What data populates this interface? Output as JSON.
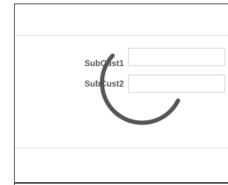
{
  "form": {
    "fields": [
      {
        "label": "SubCust1",
        "value": "",
        "placeholder": ""
      },
      {
        "label": "SubCust2",
        "value": "",
        "placeholder": ""
      }
    ]
  },
  "loading": {
    "icon": "loading-spinner-icon",
    "color": "#555555"
  }
}
